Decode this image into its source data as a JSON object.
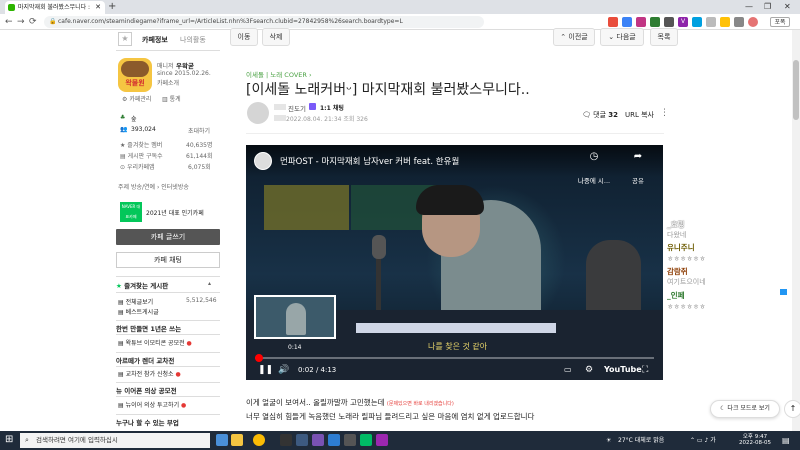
{
  "browser": {
    "tab_title": "마지막재회 불러봤스무니다 : ",
    "url": "cafe.naver.com/steamindiegame?iframe_url=/ArticleList.nhn%3Fsearch.clubid=27842958%26search.boardtype=L",
    "new_tab": "+",
    "win_min": "—",
    "win_max": "❐",
    "win_close": "✕",
    "back": "←",
    "forward": "→",
    "reload": "⟳",
    "profile_btn": "포폭"
  },
  "sidebar": {
    "tab_info": "카페정보",
    "tab_activity": "나의활동",
    "manager_label": "매니저",
    "manager_name": "우왁굳",
    "since": "since 2015.02.26.",
    "cafe_intro": "카페소개",
    "cafe_logo_text": "왁물원",
    "cafe_manage": "카페관리",
    "stats": "통계",
    "grade": "숲",
    "members": "393,024",
    "invite": "초대하기",
    "fav_label": "즐겨찾는 멤버",
    "fav_count": "40,635명",
    "sub_label": "게시판 구독수",
    "sub_count": "61,144회",
    "cafe_sub_label": "우리카페앱",
    "cafe_sub_count": "6,075회",
    "topic": "주제  방송/연예 › 인터넷방송",
    "badge_text": "NAVER 대표카페",
    "award": "2021년 대표 인기카페",
    "write_btn": "카페 글쓰기",
    "chat_btn": "카페 채팅",
    "fav_boards": "즐겨찾는 게시판",
    "all_posts": "전체글보기",
    "all_posts_count": "5,512,546",
    "best_posts": "베스트게시글",
    "sect1": "한번 만들면 1년은 쓰는",
    "sect1_item": "왁튜브 이모티콘 공모전",
    "sect2": "아르떼가 렌더 교차전",
    "sect2_item": "교차전 참가 신청소",
    "sect3": "뉴 이어폰 의상 공모전",
    "sect3_item": "뉴이어 의상 투고하기",
    "sect4": "누구나 할 수 있는 부업"
  },
  "toolbar": {
    "move": "이동",
    "delete": "삭제",
    "prev": "이전글",
    "next": "다음글",
    "list": "목록"
  },
  "article": {
    "breadcrumb": "이세돌 | 노래 COVER",
    "title": "[이세돌 노래커버ᵕ] 마지막재회 불러봤스무니다..",
    "author": "진도기",
    "chat_label": "1:1 채팅",
    "meta": "2022.08.04. 21:34  조회 326",
    "comments_label": "댓글",
    "comments_count": "32",
    "url_copy": "URL 복사",
    "body1": "이게 얼굴이 보여서.. 올릴까말까 고민했는데",
    "body1_note": "(문제있으면 바로 내리겠습니다)",
    "body2": "너무 열심히 힘들게 녹음했던 노래라 릴파님 들려드리고 싶은 마음에 염치 없게 업로드합니다"
  },
  "video": {
    "title": "먼파OST - 마지막재회 남자ver 커버 feat. 한유월",
    "watch_later": "나중에 시...",
    "share": "공유",
    "thumb_time": "0:14",
    "caption": "나를 찾은 것 같아",
    "time": "0:02 / 4:13",
    "progress": 0.01,
    "youtube": "YouTube"
  },
  "right_panel": {
    "name1": "_효밍",
    "line1": "다왔네",
    "name2": "유니주니",
    "line2": "ㅎㅎㅎㅎㅎㅎ",
    "name3": "감람쥐",
    "line3": "여기트으이네",
    "name4": "_인페",
    "line4": "ㅎㅎㅎㅎㅎㅎ"
  },
  "dark_mode": "다크 모드로 보기",
  "taskbar": {
    "search_placeholder": "검색하려면 여기에 입력하십시",
    "weather": "27°C  대체로 맑음",
    "time": "오후 9:47",
    "date": "2022-08-05"
  },
  "colors": {
    "naver_green": "#03c75a",
    "author_purple": "#7a5af8",
    "cafe_title_green": "#49a142"
  }
}
